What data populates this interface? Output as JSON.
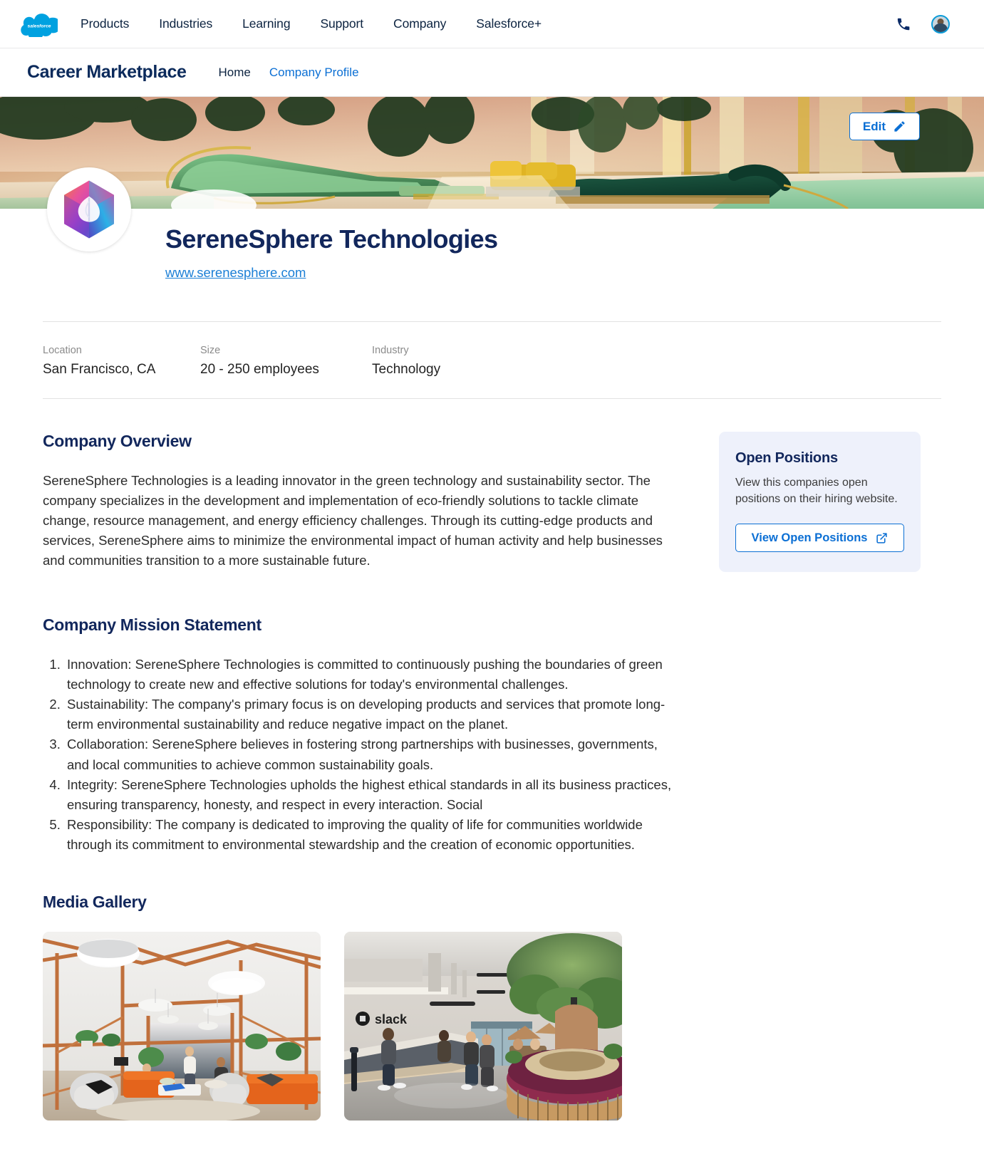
{
  "topbar": {
    "logo_alt": "salesforce",
    "nav_items": [
      {
        "label": "Products"
      },
      {
        "label": "Industries"
      },
      {
        "label": "Learning"
      },
      {
        "label": "Support"
      },
      {
        "label": "Company"
      },
      {
        "label": "Salesforce+"
      }
    ],
    "phone_icon": "phone-icon",
    "avatar_icon": "user-avatar"
  },
  "subnav": {
    "brand": "Career Marketplace",
    "links": [
      {
        "label": "Home",
        "active": false
      },
      {
        "label": "Company Profile",
        "active": true
      }
    ]
  },
  "hero": {
    "edit_label": "Edit",
    "edit_icon": "pencil-icon"
  },
  "company": {
    "logo_icon": "serenesphere-hexagon-logo",
    "name": "SereneSphere Technologies",
    "website": "www.serenesphere.com"
  },
  "meta": [
    {
      "label": "Location",
      "value": "San Francisco, CA"
    },
    {
      "label": "Size",
      "value": "20 - 250 employees"
    },
    {
      "label": "Industry",
      "value": "Technology"
    }
  ],
  "overview": {
    "title": "Company Overview",
    "text": "SereneSphere Technologies is a leading innovator in the green technology and sustainability sector. The company specializes in the development and implementation of eco-friendly solutions to tackle climate change, resource management, and energy efficiency challenges. Through its cutting-edge products and services, SereneSphere aims to minimize the environmental impact of human activity and help businesses and communities transition to a more sustainable future."
  },
  "mission": {
    "title": "Company Mission Statement",
    "items": [
      "Innovation: SereneSphere Technologies is committed to continuously pushing the boundaries of green technology to create new and effective solutions for today's environmental challenges.",
      "Sustainability: The company's primary focus is on developing products and services that promote long-term environmental sustainability and reduce negative impact on the planet.",
      "Collaboration: SereneSphere believes in fostering strong partnerships with businesses, governments, and local communities to achieve common sustainability goals.",
      "Integrity: SereneSphere Technologies upholds the highest ethical standards in all its business practices, ensuring transparency, honesty, and respect in every interaction. Social",
      "Responsibility: The company is dedicated to improving the quality of life for communities worldwide through its commitment to environmental stewardship and the creation of economic opportunities."
    ]
  },
  "positions": {
    "title": "Open Positions",
    "description": "View this companies open positions on their hiring website.",
    "button_label": "View Open Positions",
    "button_icon": "external-link-icon"
  },
  "gallery": {
    "title": "Media Gallery",
    "items": [
      {
        "alt": "office-lounge-wood-frame-photo"
      },
      {
        "alt": "slack-office-lobby-photo"
      }
    ]
  },
  "colors": {
    "brand_navy": "#12275c",
    "link_blue": "#0b6fd4",
    "card_bg": "#eef1fb",
    "text": "#2b2b2b",
    "muted": "#8b8b8b"
  }
}
